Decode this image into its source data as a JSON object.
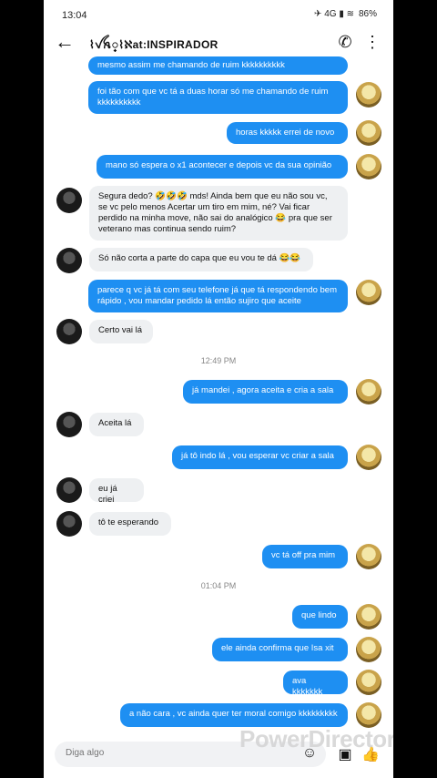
{
  "status_bar": {
    "time": "13:04",
    "icons": "✈ 4G ▮ ≋",
    "battery": "86"
  },
  "header": {
    "title": "⌇ꪜꫝ꫶⌇ℵat:INSPIRADOR",
    "back_icon": "←",
    "call_icon": "✆",
    "menu_icon": "⋮"
  },
  "messages": [
    {
      "dir": "out",
      "text": "mesmo assim me chamando de ruim kkkkkkkkkk"
    },
    {
      "dir": "out",
      "text": "foi tão com que vc tá a duas horar só me chamando de ruim kkkkkkkkkk"
    },
    {
      "dir": "out",
      "text": "horas kkkkk errei de novo"
    },
    {
      "dir": "out",
      "text": "mano só espera o x1 acontecer e depois vc da sua opinião"
    },
    {
      "dir": "in",
      "text": "Segura dedo? 🤣🤣🤣 mds! Ainda bem que eu não sou vc, se vc pelo menos Acertar um tiro em mim, né? Vai ficar perdido na minha move, não sai do analógico 😂 pra que ser veterano mas continua sendo ruim?"
    },
    {
      "dir": "in",
      "text": "Só não corta a parte do capa que eu vou te dá 😂😂"
    },
    {
      "dir": "out",
      "text": "parece q vc já tá com seu telefone já que tá respondendo bem rápido , vou mandar pedido lá então sujiro que aceite"
    },
    {
      "dir": "in",
      "text": "Certo vai lá"
    },
    {
      "dir": "out",
      "text": "já mandei , agora aceita e cria a sala"
    },
    {
      "dir": "in",
      "text": "Aceita lá"
    },
    {
      "dir": "out",
      "text": "já tô indo lá , vou esperar vc criar a sala"
    },
    {
      "dir": "in",
      "text": "eu já criei"
    },
    {
      "dir": "in",
      "text": "tô te esperando"
    },
    {
      "dir": "out",
      "text": "vc tá off pra mim"
    },
    {
      "dir": "out",
      "text": "que lindo"
    },
    {
      "dir": "out",
      "text": "ele ainda confirma que Isa xit"
    },
    {
      "dir": "out",
      "text": "ava kkkkkkk"
    },
    {
      "dir": "out",
      "text": "a não cara , vc ainda quer ter moral comigo kkkkkkkkk"
    }
  ],
  "timestamps": [
    "12:49 PM",
    "01:04 PM"
  ],
  "composer": {
    "placeholder": "Diga algo",
    "emoji_icon": "☺",
    "image_icon": "▣",
    "like_icon": "👍"
  },
  "watermark": "PowerDirector",
  "colors": {
    "outgoing": "#1e8ff2",
    "incoming": "#eef0f2"
  }
}
